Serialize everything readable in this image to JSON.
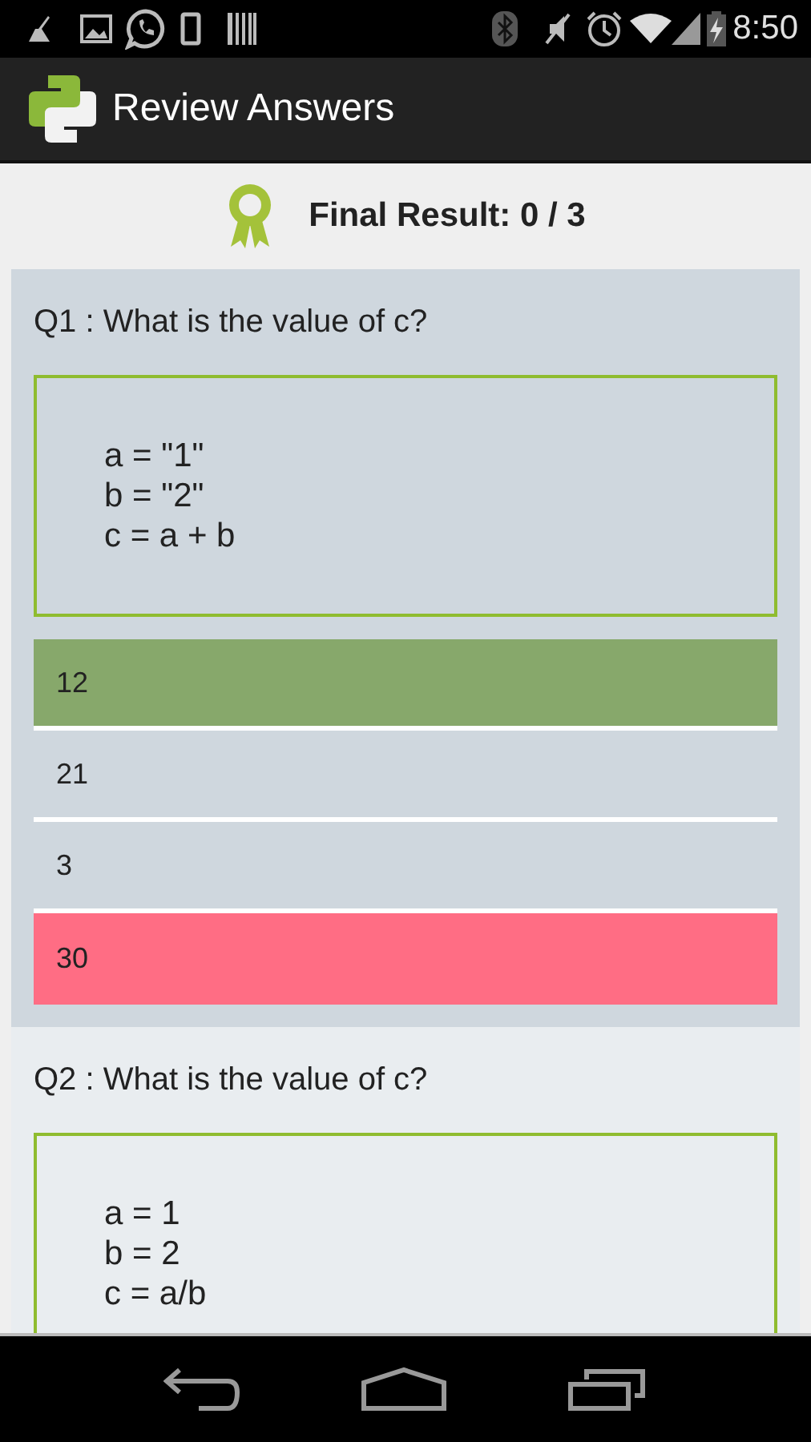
{
  "status_bar": {
    "time": "8:50"
  },
  "app_bar": {
    "title": "Review Answers"
  },
  "result": {
    "text": "Final Result: 0 / 3"
  },
  "questions": [
    {
      "title": "Q1 : What is the value of c?",
      "selected": true,
      "code": [
        "a = \"1\"",
        "b = \"2\"",
        "c = a + b"
      ],
      "answers": [
        {
          "text": "12",
          "kind": "correct"
        },
        {
          "text": "21",
          "kind": "plain"
        },
        {
          "text": "3",
          "kind": "plain"
        },
        {
          "text": "30",
          "kind": "wrong"
        }
      ]
    },
    {
      "title": "Q2 : What is the value of c?",
      "selected": false,
      "code": [
        "a = 1",
        "b = 2",
        "c = a/b"
      ]
    }
  ]
}
